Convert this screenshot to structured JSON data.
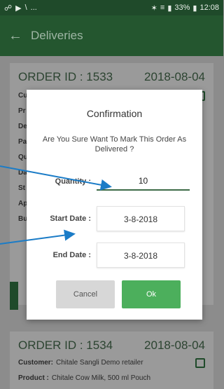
{
  "status_bar": {
    "left_icons": [
      "notification-icon",
      "play-icon",
      "signal-slash-icon"
    ],
    "dots": "...",
    "right_text": "33%",
    "time": "12:08",
    "right_icons": [
      "bluetooth-icon",
      "wifi-icon",
      "signal-icon",
      "battery-icon"
    ]
  },
  "app_bar": {
    "title": "Deliveries"
  },
  "orders": [
    {
      "order_id": "ORDER ID : 1533",
      "date": "2018-08-04",
      "rows": [
        {
          "label": "Cu",
          "value": ""
        },
        {
          "label": "Pr",
          "value": ""
        },
        {
          "label": "De",
          "value": ""
        },
        {
          "label": "Pa",
          "value": ""
        },
        {
          "label": "Qu",
          "value": ""
        },
        {
          "label": "Da",
          "value": ""
        },
        {
          "label": "St",
          "value": ""
        },
        {
          "label": "Ap",
          "value": ""
        },
        {
          "label": "Bu",
          "value": ""
        }
      ]
    },
    {
      "order_id": "ORDER ID : 1534",
      "date": "2018-08-04",
      "customer_label": "Customer:",
      "customer_value": "Chitale Sangli Demo retailer",
      "product_label": "Product :",
      "product_value": "Chitale Cow Milk, 500 ml Pouch"
    }
  ],
  "dialog": {
    "title": "Confirmation",
    "message": "Are You Sure Want To Mark This Order As Delivered ?",
    "quantity_label": "Quantity :",
    "quantity_value": "10",
    "start_date_label": "Start Date :",
    "start_date_value": "3-8-2018",
    "end_date_label": "End Date :",
    "end_date_value": "3-8-2018",
    "cancel_label": "Cancel",
    "ok_label": "Ok"
  },
  "colors": {
    "app_bar": "#24562f",
    "ok_button": "#4caf5c",
    "arrow": "#1b7cc7"
  }
}
